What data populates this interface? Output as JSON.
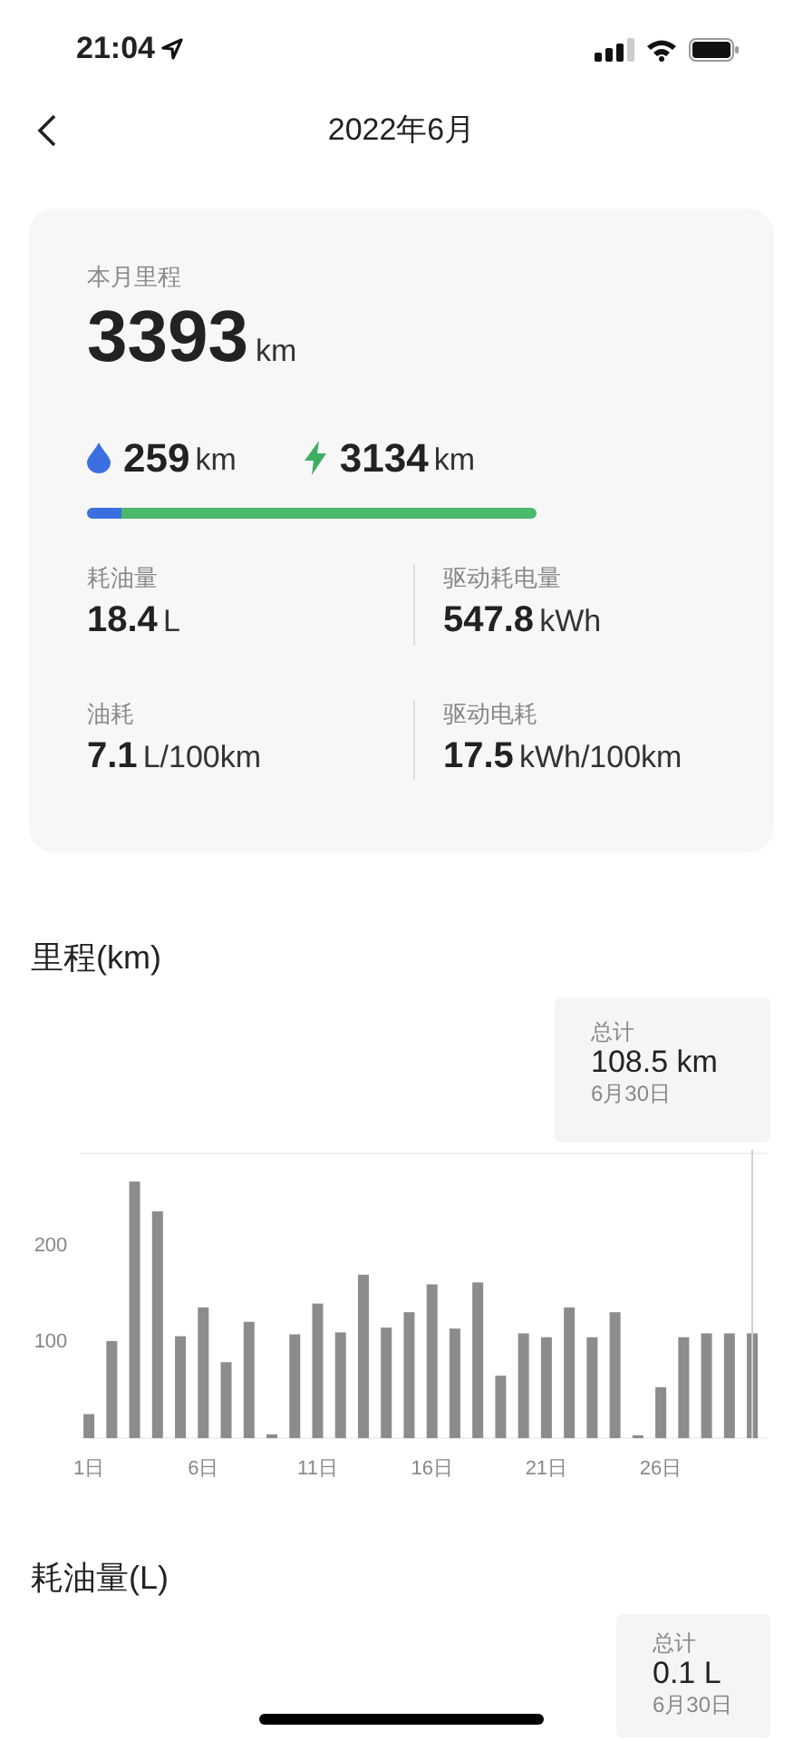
{
  "status_bar": {
    "time": "21:04"
  },
  "nav": {
    "title": "2022年6月"
  },
  "summary": {
    "label": "本月里程",
    "value": "3393",
    "unit": "km",
    "fuel": {
      "value": "259",
      "unit": "km"
    },
    "electric": {
      "value": "3134",
      "unit": "km"
    },
    "level": 0.076,
    "stats": [
      {
        "label": "耗油量",
        "value": "18.4",
        "unit": "L"
      },
      {
        "label": "驱动耗电量",
        "value": "547.8",
        "unit": "kWh"
      },
      {
        "label": "油耗",
        "value": "7.1",
        "unit": "L/100km"
      },
      {
        "label": "驱动电耗",
        "value": "17.5",
        "unit": "kWh/100km"
      }
    ]
  },
  "sections": [
    {
      "title": "里程(km)",
      "tooltip": {
        "label": "总计",
        "value": "108.5 km",
        "date": "6月30日"
      },
      "chart_data": {
        "type": "bar",
        "x": [
          1,
          2,
          3,
          4,
          5,
          6,
          7,
          8,
          9,
          10,
          11,
          12,
          13,
          14,
          15,
          16,
          17,
          18,
          19,
          20,
          21,
          22,
          23,
          24,
          25,
          26,
          27,
          28,
          29,
          30
        ],
        "series": [
          {
            "color": "#8c8c8c",
            "values": [
              25,
              101,
              267,
              236,
              106,
              136,
              79,
              121,
              4,
              108,
              140,
              110,
              170,
              115,
              131,
              160,
              114,
              162,
              65,
              109,
              105,
              136,
              105,
              131,
              3,
              53,
              105,
              109,
              109,
              109
            ]
          }
        ],
        "ref_lines": [
          {
            "axis": "x",
            "value": 30
          }
        ],
        "xlim": [
          0.6,
          30.6
        ],
        "ylim": [
          0,
          300
        ],
        "yticks": [
          100,
          200
        ],
        "xticks": [
          {
            "value": 1,
            "label": "1日"
          },
          {
            "value": 6,
            "label": "6日"
          },
          {
            "value": 11,
            "label": "11日"
          },
          {
            "value": 16,
            "label": "16日"
          },
          {
            "value": 21,
            "label": "21日"
          },
          {
            "value": 26,
            "label": "26日"
          }
        ]
      }
    },
    {
      "title": "耗油量(L)",
      "tooltip": {
        "label": "总计",
        "value": "0.1 L",
        "date": "6月30日"
      }
    }
  ]
}
